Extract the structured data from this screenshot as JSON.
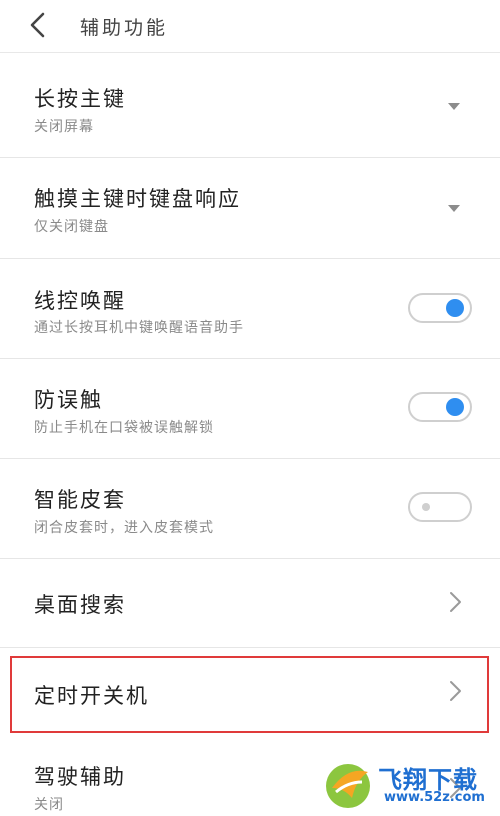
{
  "header": {
    "title": "辅助功能",
    "back_icon": "chevron-left-icon"
  },
  "items": [
    {
      "label": "长按主键",
      "sub": "关闭屏幕",
      "control": "dropdown"
    },
    {
      "label": "触摸主键时键盘响应",
      "sub": "仅关闭键盘",
      "control": "dropdown"
    },
    {
      "label": "线控唤醒",
      "sub": "通过长按耳机中键唤醒语音助手",
      "control": "toggle",
      "on": true
    },
    {
      "label": "防误触",
      "sub": "防止手机在口袋被误触解锁",
      "control": "toggle",
      "on": true
    },
    {
      "label": "智能皮套",
      "sub": "闭合皮套时，进入皮套模式",
      "control": "toggle",
      "on": false
    },
    {
      "label": "桌面搜索",
      "control": "chevron"
    },
    {
      "label": "定时开关机",
      "control": "chevron",
      "highlighted": true
    },
    {
      "label": "驾驶辅助",
      "sub": "关闭",
      "control": "chevron"
    }
  ],
  "colors": {
    "toggle_on": "#2f8ef0",
    "highlight_border": "#e03a3a",
    "watermark_blue": "#1f6fd1"
  },
  "watermark": {
    "name": "飞翔下载",
    "url": "www.52z.com"
  }
}
